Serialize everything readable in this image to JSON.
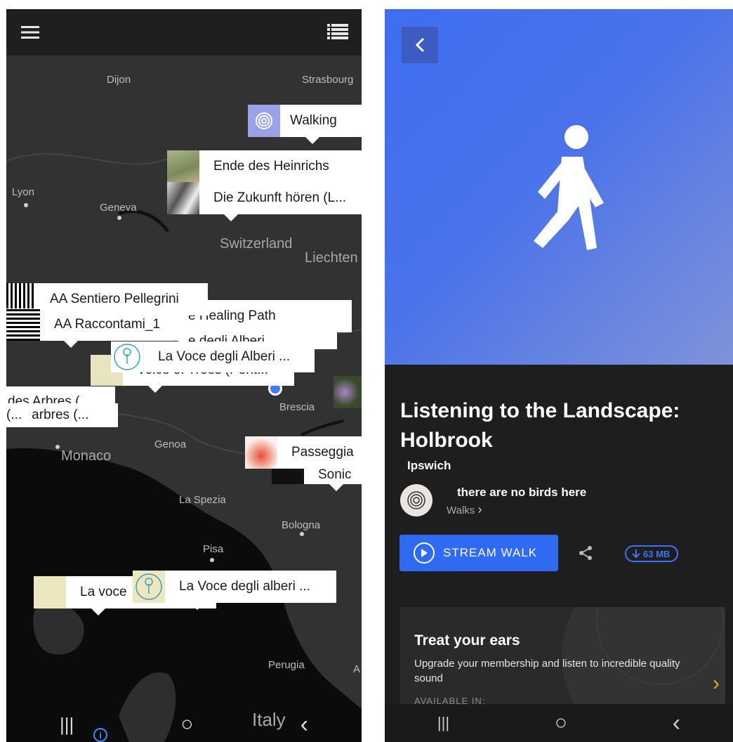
{
  "left": {
    "topbar": {
      "menu_icon": "hamburger-icon",
      "list_icon": "list-view-icon"
    },
    "map_labels": [
      "Dijon",
      "Strasbourg",
      "Lyon",
      "Geneva",
      "Switzerland",
      "Liechten",
      "Brescia",
      "Monaco",
      "Genoa",
      "La Spezia",
      "Bologna",
      "Pisa",
      "Perugia",
      "A",
      "Italy"
    ],
    "callouts": [
      "Walking",
      "Ende des Heinrichs",
      "Die Zukunft hören (L...",
      "AA Sentiero Pellegrini",
      "e Healing Path",
      "AA Raccontami_1",
      "e degli Alberi",
      "La Voce degli Alberi ...",
      "Voice of Trees (Pont...",
      "des Arbres (...",
      "arbres (...",
      "(...",
      "Passeggia",
      "Sonic",
      "La voce",
      "La Voce degli alberi ..."
    ],
    "nav": {
      "recent": "|||",
      "home": "○",
      "back": "‹",
      "info_icon": "info-icon"
    }
  },
  "right": {
    "back_icon": "chevron-left-icon",
    "hero_icon": "walking-person-icon",
    "hero_color_start": "#3f6ef2",
    "hero_color_end": "#7f93d8",
    "title": "Listening to the Landscape: Holbrook",
    "location": "Ipswich",
    "author_name": "there are no birds here",
    "author_type": "Walks",
    "stream_label": "STREAM WALK",
    "share_icon": "share-icon",
    "download_size": "63 MB",
    "promo_title": "Treat your ears",
    "promo_text": "Upgrade your membership and listen to incredible quality sound",
    "promo_avail": "AVAILABLE IN:",
    "nav": {
      "recent": "|||",
      "home": "○",
      "back": "‹"
    }
  }
}
